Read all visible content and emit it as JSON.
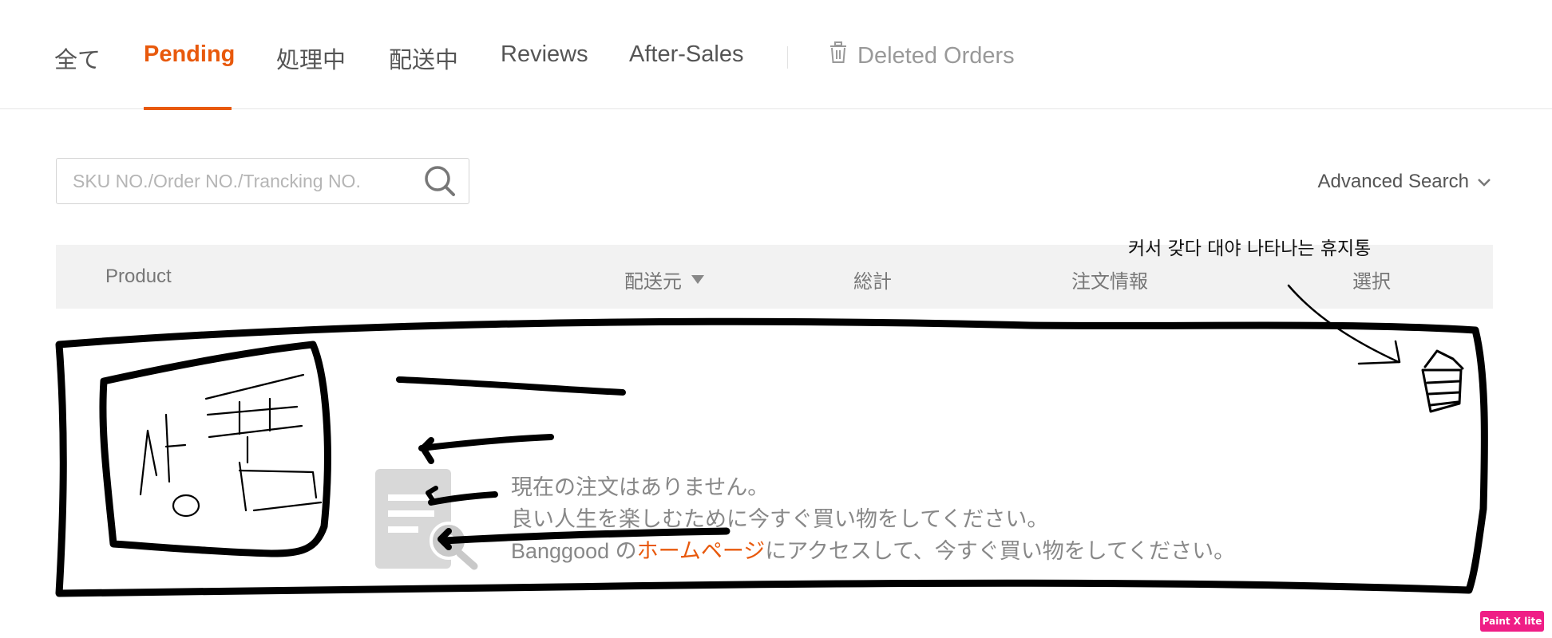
{
  "tabs": [
    {
      "label": "全て"
    },
    {
      "label": "Pending",
      "active": true
    },
    {
      "label": "処理中"
    },
    {
      "label": "配送中"
    },
    {
      "label": "Reviews"
    },
    {
      "label": "After-Sales"
    }
  ],
  "deleted_orders": {
    "label": "Deleted Orders",
    "icon": "trash-icon"
  },
  "search": {
    "placeholder": "SKU NO./Order NO./Trancking NO.",
    "value": "",
    "icon": "search-icon"
  },
  "advanced_search": {
    "label": "Advanced Search",
    "icon": "chevron-down-icon"
  },
  "table_header": {
    "product": "Product",
    "ship_from": "配送元",
    "total": "総計",
    "order_info": "注文情報",
    "select": "選択"
  },
  "empty_state": {
    "line1": "現在の注文はありません。",
    "line2": "良い人生を楽しむために今すぐ買い物をしてください。",
    "line3_prefix": "Banggood の",
    "line3_link": "ホームページ",
    "line3_suffix": "にアクセスして、今すぐ買い物をしてください。",
    "icon": "empty-orders-icon"
  },
  "annotation": {
    "note": "커서 갖다 대야 나타나는 휴지통",
    "sketch_product_text": "상품"
  },
  "watermark": "Paint X lite",
  "colors": {
    "accent": "#e8590c",
    "muted": "#888888",
    "header_bg": "#f2f2f2",
    "watermark": "#ef1e86"
  }
}
